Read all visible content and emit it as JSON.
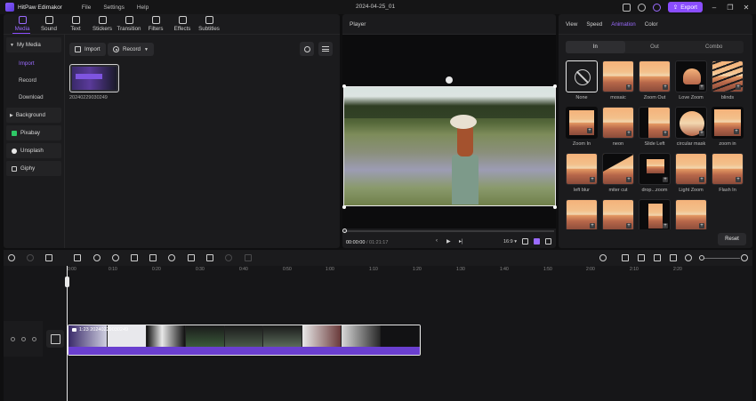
{
  "app": {
    "name": "HitPaw Edimakor",
    "document_title": "2024-04-25_01"
  },
  "menu": [
    "File",
    "Settings",
    "Help"
  ],
  "titlebar": {
    "export_label": "Export"
  },
  "tabs": [
    {
      "label": "Media",
      "icon": "media-icon",
      "active": true
    },
    {
      "label": "Sound",
      "icon": "music-icon",
      "active": false
    },
    {
      "label": "Text",
      "icon": "text-icon",
      "active": false
    },
    {
      "label": "Stickers",
      "icon": "sticker-icon",
      "active": false
    },
    {
      "label": "Transition",
      "icon": "transition-icon",
      "active": false
    },
    {
      "label": "Filters",
      "icon": "filter-icon",
      "active": false
    },
    {
      "label": "Effects",
      "icon": "effects-icon",
      "active": false
    },
    {
      "label": "Subtitles",
      "icon": "subtitles-icon",
      "active": false
    }
  ],
  "sidebar": {
    "my_media": "My Media",
    "sub": [
      "Import",
      "Record",
      "Download"
    ],
    "background": "Background",
    "items": [
      "Pixabay",
      "Unsplash",
      "Giphy"
    ]
  },
  "media_toolbar": {
    "import": "Import",
    "record": "Record"
  },
  "media_items": [
    {
      "name": "20240229030249"
    }
  ],
  "player": {
    "title": "Player",
    "current_time": "00:00:00",
    "separator": "/",
    "duration": "01:21:17",
    "ratio": "16:9"
  },
  "right_panel": {
    "tabs": [
      "View",
      "Speed",
      "Animation",
      "Color"
    ],
    "active_tab": "Animation",
    "segments": [
      "In",
      "Out",
      "Combo"
    ],
    "active_segment": "In",
    "animations": [
      "None",
      "mosaic",
      "Zoom Out",
      "Love Zoom",
      "blinds",
      "Zoom In",
      "neon",
      "Slide Left",
      "circular mask",
      "zoom in",
      "left blur",
      "miter cut",
      "drop...zoom",
      "Light Zoom",
      "Flash In",
      "",
      "",
      "",
      ""
    ],
    "reset": "Reset"
  },
  "ruler": [
    "0:00",
    "0:10",
    "0:20",
    "0:30",
    "0:40",
    "0:50",
    "1:00",
    "1:10",
    "1:20",
    "1:30",
    "1:40",
    "1:50",
    "2:00",
    "2:10",
    "2:20"
  ],
  "clip": {
    "label": "1:23  20240229030249"
  },
  "colors": {
    "accent": "#8a4dff",
    "panel": "#1b1b1d",
    "background": "#0f0f10"
  }
}
